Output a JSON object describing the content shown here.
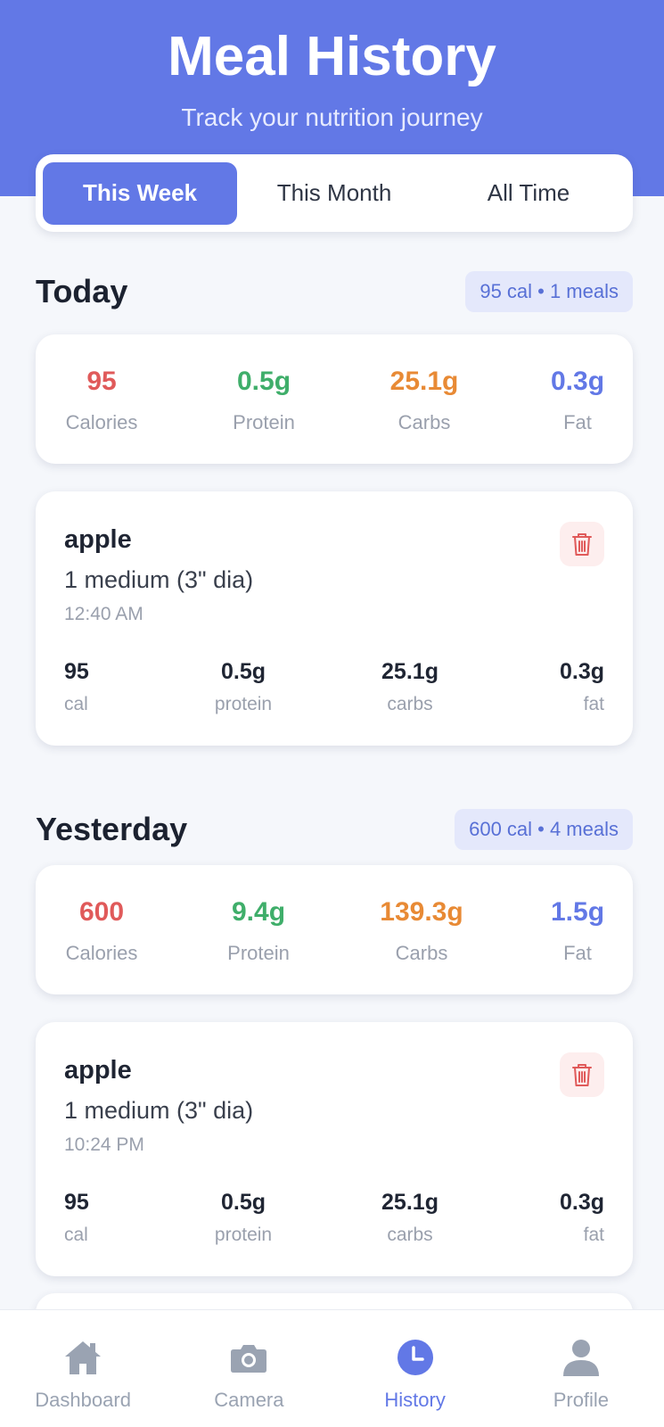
{
  "header": {
    "title": "Meal History",
    "subtitle": "Track your nutrition journey"
  },
  "tabs": [
    {
      "label": "This Week",
      "active": true
    },
    {
      "label": "This Month",
      "active": false
    },
    {
      "label": "All Time",
      "active": false
    }
  ],
  "days": [
    {
      "title": "Today",
      "badge": "95 cal • 1 meals",
      "summary": {
        "calories": "95",
        "protein": "0.5g",
        "carbs": "25.1g",
        "fat": "0.3g",
        "labels": {
          "calories": "Calories",
          "protein": "Protein",
          "carbs": "Carbs",
          "fat": "Fat"
        }
      },
      "meals": [
        {
          "name": "apple",
          "portion": "1 medium (3\" dia)",
          "time": "12:40 AM",
          "cal": "95",
          "protein": "0.5g",
          "carbs": "25.1g",
          "fat": "0.3g",
          "labels": {
            "cal": "cal",
            "protein": "protein",
            "carbs": "carbs",
            "fat": "fat"
          }
        }
      ]
    },
    {
      "title": "Yesterday",
      "badge": "600 cal • 4 meals",
      "summary": {
        "calories": "600",
        "protein": "9.4g",
        "carbs": "139.3g",
        "fat": "1.5g",
        "labels": {
          "calories": "Calories",
          "protein": "Protein",
          "carbs": "Carbs",
          "fat": "Fat"
        }
      },
      "meals": [
        {
          "name": "apple",
          "portion": "1 medium (3\" dia)",
          "time": "10:24 PM",
          "cal": "95",
          "protein": "0.5g",
          "carbs": "25.1g",
          "fat": "0.3g",
          "labels": {
            "cal": "cal",
            "protein": "protein",
            "carbs": "carbs",
            "fat": "fat"
          }
        }
      ]
    }
  ],
  "nav": [
    {
      "label": "Dashboard",
      "icon": "home-icon",
      "active": false
    },
    {
      "label": "Camera",
      "icon": "camera-icon",
      "active": false
    },
    {
      "label": "History",
      "icon": "clock-icon",
      "active": true
    },
    {
      "label": "Profile",
      "icon": "user-icon",
      "active": false
    }
  ],
  "colors": {
    "accent": "#6278e6",
    "calories": "#e05a5a",
    "protein": "#3fae6a",
    "carbs": "#e88a35",
    "fat": "#6278e6"
  }
}
